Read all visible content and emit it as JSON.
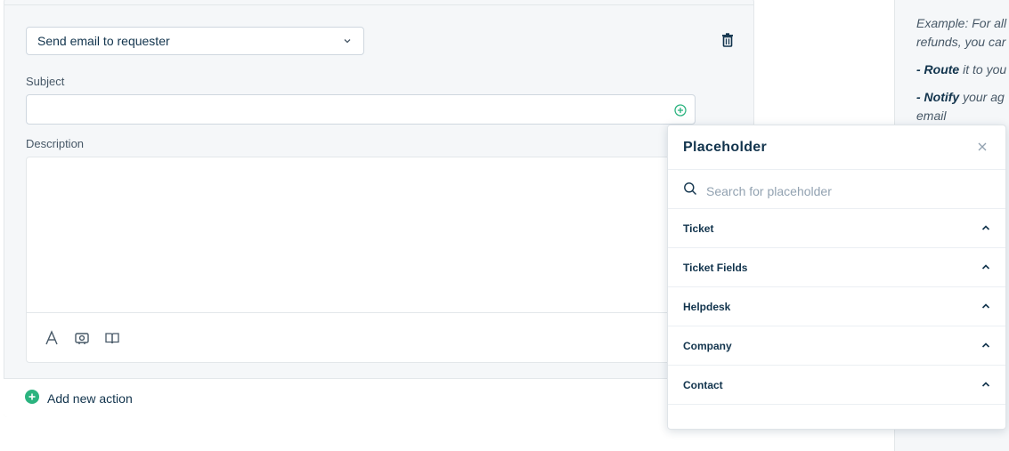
{
  "action": {
    "selected": "Send email to requester"
  },
  "subject": {
    "label": "Subject",
    "value": ""
  },
  "description": {
    "label": "Description"
  },
  "add_action": {
    "label": "Add new action"
  },
  "right_panel": {
    "line1": "Example: For all",
    "line2": "refunds, you car",
    "route_bold": "- Route",
    "route_rest": " it to you",
    "notify_bold": "- Notify",
    "notify_rest": " your ag",
    "line5": "email"
  },
  "placeholder_popover": {
    "title": "Placeholder",
    "search_placeholder": "Search for placeholder",
    "categories": [
      {
        "label": "Ticket"
      },
      {
        "label": "Ticket Fields"
      },
      {
        "label": "Helpdesk"
      },
      {
        "label": "Company"
      },
      {
        "label": "Contact"
      }
    ]
  },
  "colors": {
    "accent_green": "#2bb37f",
    "text_dark": "#12344d",
    "border": "#cfd7df",
    "panel_bg": "#f5f7f9"
  }
}
